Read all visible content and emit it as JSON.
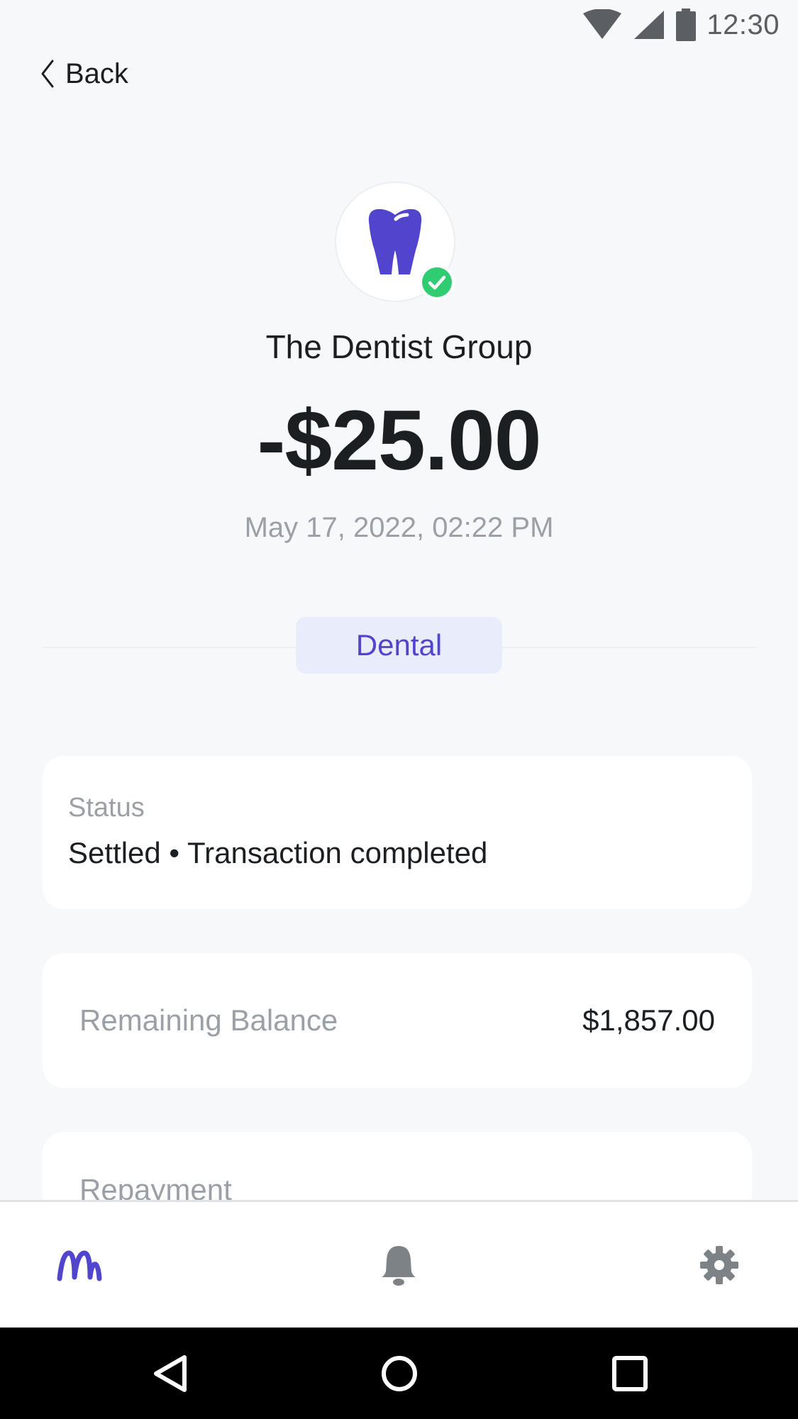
{
  "status_bar": {
    "time": "12:30",
    "icons": [
      "wifi-icon",
      "cellular-signal-icon",
      "battery-icon"
    ]
  },
  "header": {
    "back_label": "Back"
  },
  "transaction": {
    "merchant_icon": "tooth-icon",
    "verified_icon": "check-circle-icon",
    "merchant_name": "The Dentist Group",
    "amount": "-$25.00",
    "date": "May 17, 2022, 02:22 PM",
    "category": "Dental"
  },
  "status_card": {
    "label": "Status",
    "value": "Settled • Transaction completed"
  },
  "balance_card": {
    "label": "Remaining Balance",
    "value": "$1,857.00"
  },
  "repayment_card": {
    "label": "Repayment"
  },
  "bottom_nav": {
    "items": [
      "home-logo-icon",
      "bell-icon",
      "gear-icon"
    ]
  },
  "system_nav": {
    "items": [
      "back-triangle-icon",
      "home-circle-icon",
      "recents-square-icon"
    ]
  },
  "colors": {
    "accent": "#5145cd",
    "success": "#2fcc71",
    "background": "#f7f8fa",
    "muted_text": "#9aa0a6",
    "icon_gray": "#7d8287"
  }
}
